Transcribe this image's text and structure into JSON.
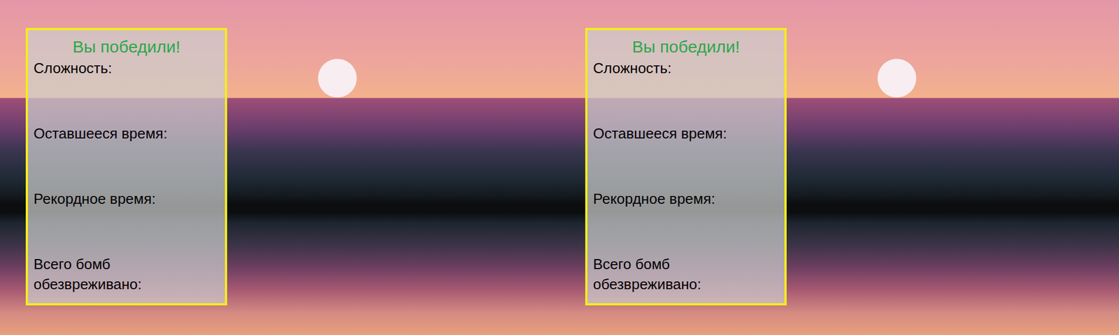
{
  "panels": [
    {
      "title": "Вы победили!",
      "fields": [
        {
          "label": "Сложность:"
        },
        {
          "label": "Оставшееся время:"
        },
        {
          "label": "Рекордное время:"
        },
        {
          "label": "Всего бомб обезвреживано:"
        }
      ]
    },
    {
      "title": "Вы победили!",
      "fields": [
        {
          "label": "Сложность:"
        },
        {
          "label": "Оставшееся время:"
        },
        {
          "label": "Рекордное время:"
        },
        {
          "label": "Всего бомб обезвреживано:"
        }
      ]
    }
  ]
}
